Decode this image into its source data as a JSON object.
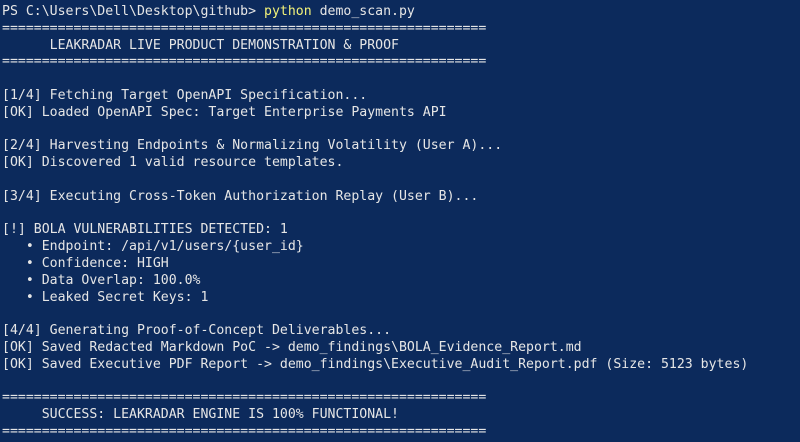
{
  "prompt": {
    "path": "PS C:\\Users\\Dell\\Desktop\\github> ",
    "command": "python",
    "args": " demo_scan.py"
  },
  "lines": [
    "=============================================================",
    "      LEAKRADAR LIVE PRODUCT DEMONSTRATION & PROOF",
    "=============================================================",
    "",
    "[1/4] Fetching Target OpenAPI Specification...",
    "[OK] Loaded OpenAPI Spec: Target Enterprise Payments API",
    "",
    "[2/4] Harvesting Endpoints & Normalizing Volatility (User A)...",
    "[OK] Discovered 1 valid resource templates.",
    "",
    "[3/4] Executing Cross-Token Authorization Replay (User B)...",
    "",
    "[!] BOLA VULNERABILITIES DETECTED: 1",
    "   • Endpoint: /api/v1/users/{user_id}",
    "   • Confidence: HIGH",
    "   • Data Overlap: 100.0%",
    "   • Leaked Secret Keys: 1",
    "",
    "[4/4] Generating Proof-of-Concept Deliverables...",
    "[OK] Saved Redacted Markdown PoC -> demo_findings\\BOLA_Evidence_Report.md",
    "[OK] Saved Executive PDF Report -> demo_findings\\Executive_Audit_Report.pdf (Size: 5123 bytes)",
    "",
    "=============================================================",
    "     SUCCESS: LEAKRADAR ENGINE IS 100% FUNCTIONAL!",
    "============================================================="
  ],
  "colors": {
    "background": "#0C2A5C",
    "text": "#E6E6E6",
    "command": "#F2F27A"
  }
}
